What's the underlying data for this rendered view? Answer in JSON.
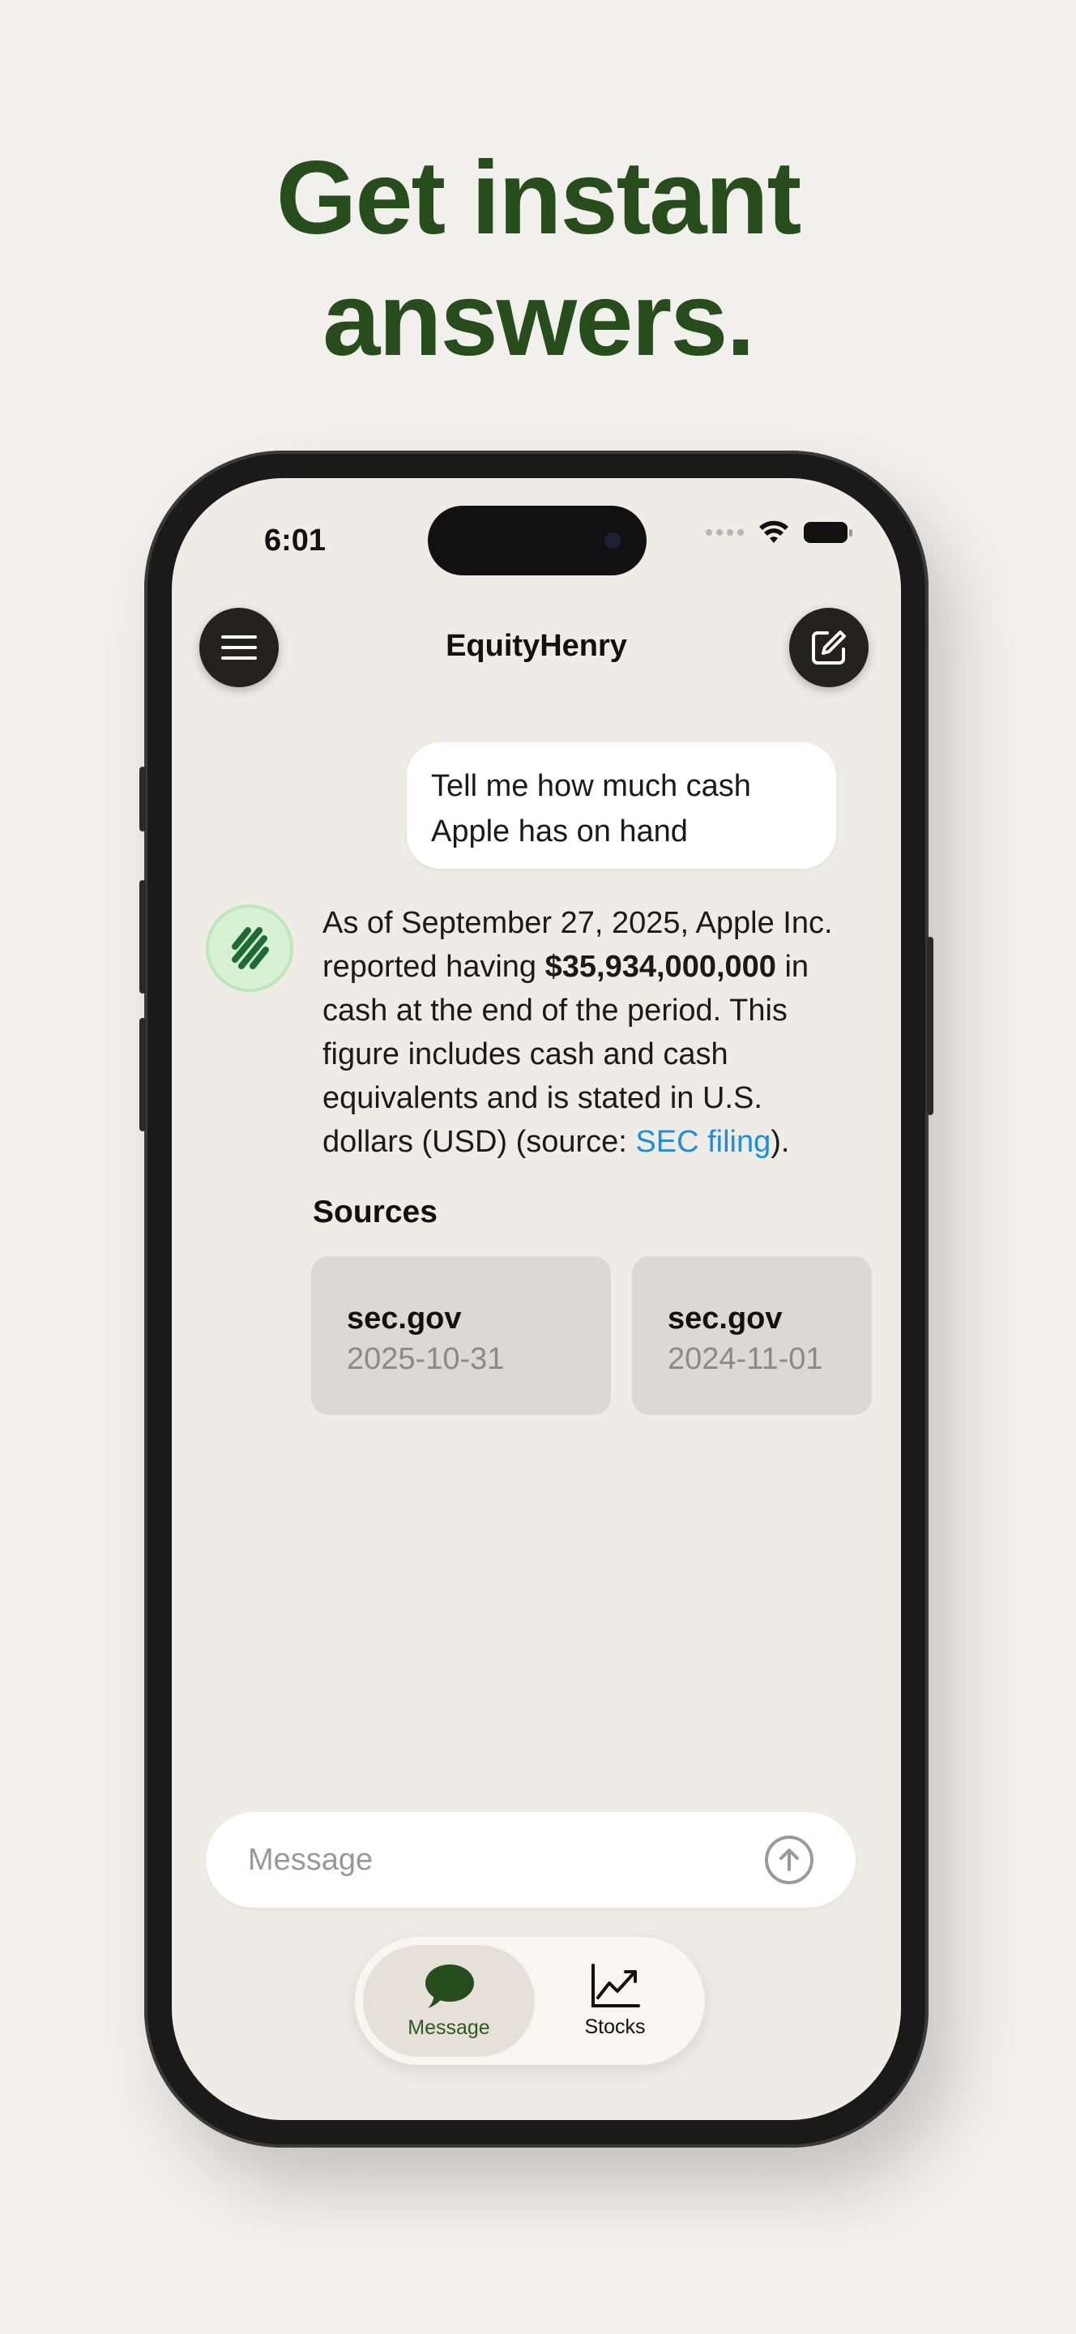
{
  "headline": {
    "line1": "Get instant",
    "line2": "answers."
  },
  "status_bar": {
    "time": "6:01"
  },
  "header": {
    "title": "EquityHenry",
    "menu_icon": "hamburger-menu-icon",
    "compose_icon": "compose-icon"
  },
  "chat": {
    "user_message": "Tell me how much cash Apple has on hand",
    "bot_message": {
      "part1": "As of September 27, 2025, Apple Inc. reported having ",
      "amount": "$35,934,000,000",
      "part2": " in cash at the end of the period. This figure includes cash and cash equivalents and is stated in U.S. dollars (USD) (source: ",
      "link": "SEC filing",
      "part3": ")."
    },
    "sources_label": "Sources",
    "sources": [
      {
        "domain": "sec.gov",
        "date": "2025-10-31"
      },
      {
        "domain": "sec.gov",
        "date": "2024-11-01"
      }
    ]
  },
  "composer": {
    "placeholder": "Message",
    "send_icon": "arrow-up-icon"
  },
  "tabs": [
    {
      "label": "Message",
      "icon": "chat-bubble-icon",
      "active": true
    },
    {
      "label": "Stocks",
      "icon": "chart-line-icon",
      "active": false
    }
  ],
  "colors": {
    "brand_green": "#264d1b",
    "link_blue": "#1a8fe0",
    "background": "#f2f0ec"
  }
}
